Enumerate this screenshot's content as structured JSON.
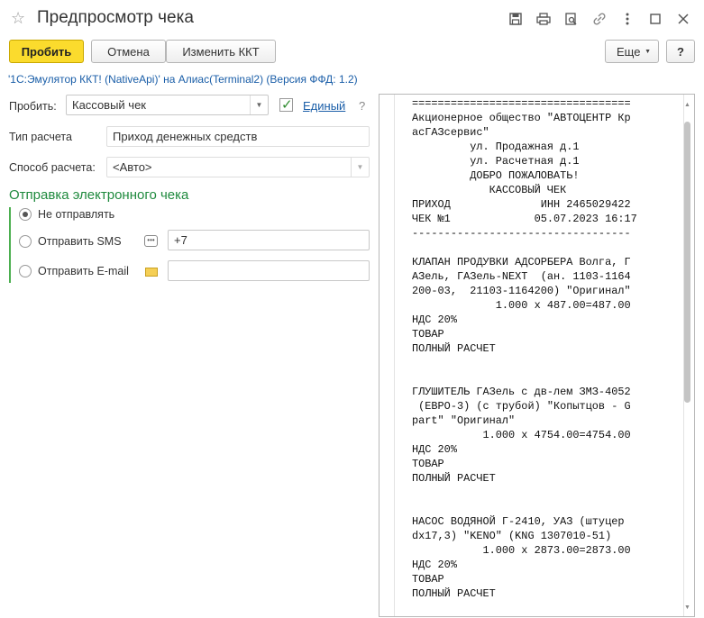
{
  "window": {
    "title": "Предпросмотр чека",
    "icons": [
      "save-icon",
      "print-icon",
      "preview-icon",
      "link-icon",
      "more-icon",
      "maximize-icon",
      "close-icon"
    ]
  },
  "toolbar": {
    "print_label": "Пробить",
    "cancel_label": "Отмена",
    "change_kkt_label": "Изменить ККТ",
    "more_label": "Еще",
    "help_label": "?"
  },
  "connection_text": "'1С:Эмулятор ККТ! (NativeApi)' на Алиас(Terminal2) (Версия ФФД: 1.2)",
  "form": {
    "print_label": "Пробить:",
    "receipt_type_value": "Кассовый чек",
    "single_checked": true,
    "single_label": "Единый",
    "help_mark": "?",
    "calc_type_label": "Тип расчета",
    "calc_type_value": "Приход денежных средств",
    "calc_method_label": "Способ расчета:",
    "calc_method_value": "<Авто>"
  },
  "electronic": {
    "section_title": "Отправка электронного чека",
    "options": [
      {
        "label": "Не отправлять",
        "selected": true
      },
      {
        "label": "Отправить SMS",
        "selected": false,
        "value": "+7"
      },
      {
        "label": "Отправить E-mail",
        "selected": false,
        "value": ""
      }
    ]
  },
  "receipt": {
    "lines": [
      "==================================",
      "Акционерное общество \"АВТОЦЕНТР Кр",
      "асГАЗсервис\"",
      "         ул. Продажная д.1",
      "         ул. Расчетная д.1",
      "         ДОБРО ПОЖАЛОВАТЬ!",
      "            КАССОВЫЙ ЧЕК",
      "ПРИХОД              ИНН 2465029422",
      "ЧЕК №1             05.07.2023 16:17",
      "----------------------------------",
      "",
      "КЛАПАН ПРОДУВКИ АДСОРБЕРА Волга, Г",
      "АЗель, ГАЗель-NEXT  (ан. 1103-1164",
      "200-03,  21103-1164200) \"Оригинал\"",
      "             1.000 x 487.00=487.00",
      "НДС 20%",
      "ТОВАР",
      "ПОЛНЫЙ РАСЧЕТ",
      "",
      "",
      "ГЛУШИТЕЛЬ ГАЗель с дв-лем ЗМЗ-4052",
      " (ЕВРО-3) (с трубой) \"Копытцов - G",
      "part\" \"Оригинал\"",
      "           1.000 x 4754.00=4754.00",
      "НДС 20%",
      "ТОВАР",
      "ПОЛНЫЙ РАСЧЕТ",
      "",
      "",
      "НАСОС ВОДЯНОЙ Г-2410, УАЗ (штуцер",
      "dx17,3) \"KENO\" (KNG 1307010-51)",
      "           1.000 x 2873.00=2873.00",
      "НДС 20%",
      "ТОВАР",
      "ПОЛНЫЙ РАСЧЕТ"
    ]
  }
}
